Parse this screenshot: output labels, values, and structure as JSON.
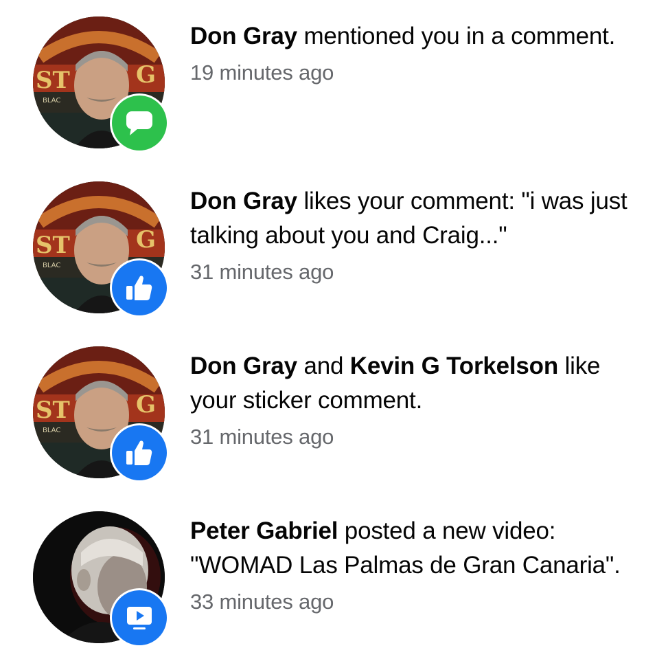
{
  "notifications": [
    {
      "actor": "Don Gray",
      "second_actor": "",
      "text": " mentioned you in a comment.",
      "time": "19 minutes ago",
      "badge_icon": "comment-icon",
      "badge_color": "#2dc14c",
      "avatar": "don-gray-avatar"
    },
    {
      "actor": "Don Gray",
      "second_actor": "",
      "text": " likes your comment: \"i was just talking about you and Craig...\"",
      "time": "31 minutes ago",
      "badge_icon": "thumbs-up-icon",
      "badge_color": "#1877f2",
      "avatar": "don-gray-avatar"
    },
    {
      "actor": "Don Gray",
      "connector": " and ",
      "second_actor": "Kevin G Torkelson",
      "text": " like your sticker comment.",
      "time": "31 minutes ago",
      "badge_icon": "thumbs-up-icon",
      "badge_color": "#1877f2",
      "avatar": "don-gray-avatar"
    },
    {
      "actor": "Peter Gabriel",
      "second_actor": "",
      "text": " posted a new video: \"WOMAD Las Palmas de Gran Canaria\".",
      "time": "33 minutes ago",
      "badge_icon": "video-icon",
      "badge_color": "#1877f2",
      "avatar": "peter-gabriel-avatar"
    }
  ]
}
